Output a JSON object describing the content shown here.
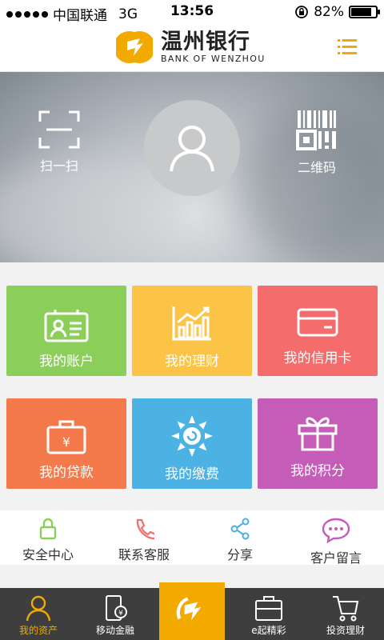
{
  "status_bar": {
    "carrier": "中国联通",
    "network": "3G",
    "time": "13:56",
    "battery": "82%",
    "battery_level": 0.82
  },
  "header": {
    "bank_name_cn": "温州银行",
    "bank_name_en": "BANK OF WENZHOU"
  },
  "hero": {
    "scan_label": "扫一扫",
    "qrcode_label": "二维码"
  },
  "tiles": [
    {
      "label": "我的账户",
      "color": "#8cce5a",
      "icon": "account-card-icon"
    },
    {
      "label": "我的理财",
      "color": "#fcc447",
      "icon": "chart-icon"
    },
    {
      "label": "我的信用卡",
      "color": "#f46c6c",
      "icon": "credit-card-icon"
    },
    {
      "label": "我的贷款",
      "color": "#f47a4c",
      "icon": "briefcase-yuan-icon"
    },
    {
      "label": "我的缴费",
      "color": "#4cb1e3",
      "icon": "sun-icon"
    },
    {
      "label": "我的积分",
      "color": "#c45cb8",
      "icon": "gift-icon"
    }
  ],
  "quick": [
    {
      "label": "安全中心",
      "icon": "lock-icon"
    },
    {
      "label": "联系客服",
      "icon": "phone-icon"
    },
    {
      "label": "分享",
      "icon": "share-icon"
    },
    {
      "label": "客户留言",
      "icon": "chat-bubble-icon"
    }
  ],
  "nav": [
    {
      "label": "我的资产",
      "active": true
    },
    {
      "label": "移动金融"
    },
    {
      "label": "e起精彩"
    },
    {
      "label": "投资理财"
    }
  ],
  "colors": {
    "accent": "#f2a900",
    "nav_bg": "#3e3e3e"
  }
}
